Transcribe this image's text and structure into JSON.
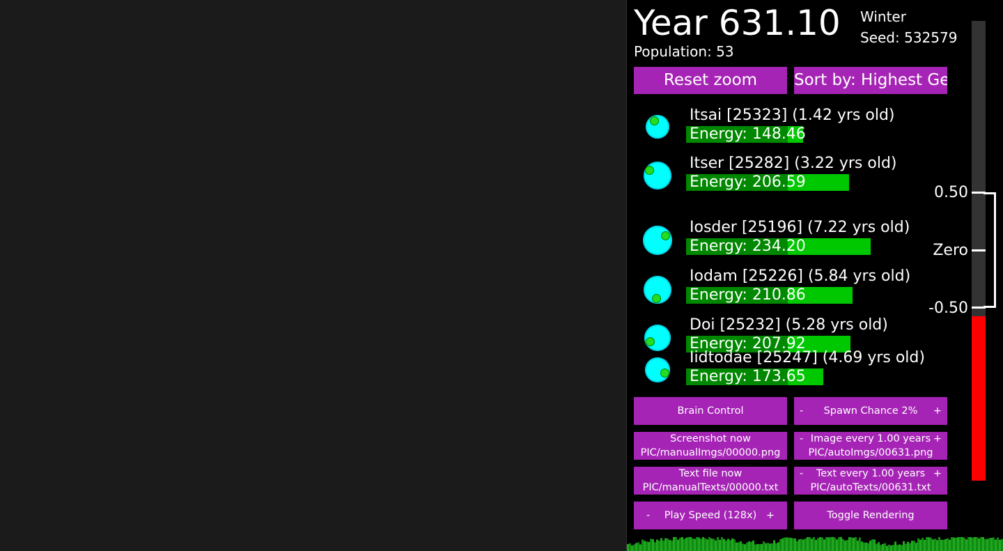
{
  "stats": {
    "year": "Year 631.10",
    "population": "Population: 53",
    "season": "Winter",
    "seed": "Seed: 532579"
  },
  "controls": {
    "reset_zoom": "Reset zoom",
    "sort_by": "Sort by: Highest Gen",
    "brain_control": "Brain Control",
    "spawn_minus": "-",
    "spawn_label": "Spawn Chance 2%",
    "spawn_plus": "+",
    "screenshot_line1": "Screenshot now",
    "screenshot_line2": "PIC/manualImgs/00000.png",
    "image_minus": "-",
    "image_line1": "Image every 1.00 years",
    "image_plus": "+",
    "image_line2": "PIC/autoImgs/00631.png",
    "textfile_line1": "Text file now",
    "textfile_line2": "PIC/manualTexts/00000.txt",
    "text_minus": "-",
    "text_line1": "Text every 1.00 years",
    "text_plus": "+",
    "text_line2": "PIC/autoTexts/00631.txt",
    "speed_minus": "-",
    "speed_label": "Play Speed (128x)",
    "speed_plus": "+",
    "toggle_rendering": "Toggle Rendering"
  },
  "creatures": [
    {
      "name": "Itsai [25323] (1.42 yrs old)",
      "energy_text": "Energy: 148.46",
      "energy": 148.46
    },
    {
      "name": "Itser [25282] (3.22 yrs old)",
      "energy_text": "Energy: 206.59",
      "energy": 206.59
    },
    {
      "name": "Iosder [25196] (7.22 yrs old)",
      "energy_text": "Energy: 234.20",
      "energy": 234.2
    },
    {
      "name": "Iodam [25226] (5.84 yrs old)",
      "energy_text": "Energy: 210.86",
      "energy": 210.86
    },
    {
      "name": "Doi [25232] (5.28 yrs old)",
      "energy_text": "Energy: 207.92",
      "energy": 207.92
    },
    {
      "name": "Iidtodae [25247] (4.69 yrs old)",
      "energy_text": "Energy: 173.65",
      "energy": 173.65
    }
  ],
  "thermometer": {
    "label_high": "0.50",
    "label_zero": "Zero",
    "label_low": "-0.50",
    "level": -0.57
  },
  "colors": {
    "button": "#a524b5",
    "energy_bar": "#00c800",
    "creature_body": "#00ffff",
    "thermo_fill": "#ff0000"
  }
}
